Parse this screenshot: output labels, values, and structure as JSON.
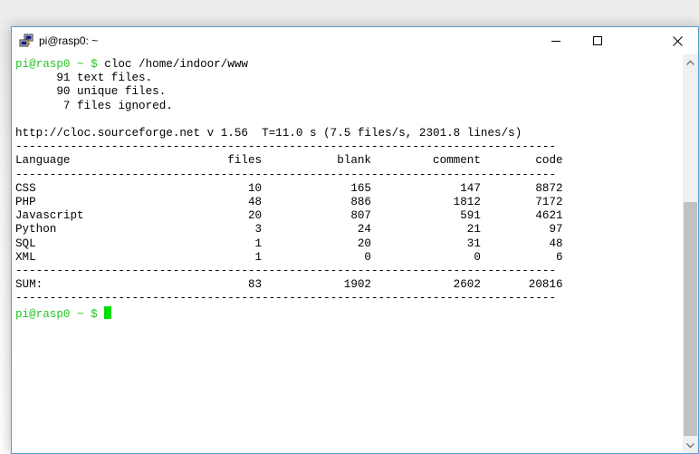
{
  "window": {
    "title": "pi@rasp0: ~",
    "minimize_glyph": "—",
    "maximize_glyph": "☐",
    "close_glyph": "✕"
  },
  "terminal": {
    "prompt": "pi@rasp0 ~ $",
    "command": " cloc /home/indoor/www",
    "output_lines": [
      "      91 text files.",
      "      90 unique files.",
      "       7 files ignored.",
      "",
      "http://cloc.sourceforge.net v 1.56  T=11.0 s (7.5 files/s, 2301.8 lines/s)"
    ],
    "separator": "-------------------------------------------------------------------------------",
    "table": {
      "headers": [
        "Language",
        "files",
        "blank",
        "comment",
        "code"
      ],
      "rows": [
        [
          "CSS",
          "10",
          "165",
          "147",
          "8872"
        ],
        [
          "PHP",
          "48",
          "886",
          "1812",
          "7172"
        ],
        [
          "Javascript",
          "20",
          "807",
          "591",
          "4621"
        ],
        [
          "Python",
          "3",
          "24",
          "21",
          "97"
        ],
        [
          "SQL",
          "1",
          "20",
          "31",
          "48"
        ],
        [
          "XML",
          "1",
          "0",
          "0",
          "6"
        ]
      ],
      "sum": [
        "SUM:",
        "83",
        "1902",
        "2602",
        "20816"
      ]
    },
    "final_prompt": "pi@rasp0 ~ $"
  },
  "colors": {
    "prompt": "#22c522",
    "cursor": "#00e000",
    "window_border": "#5b9bd5"
  },
  "icons": {
    "app": "putty-icon",
    "scroll_up": "chevron-up-icon",
    "scroll_down": "chevron-down-icon"
  }
}
